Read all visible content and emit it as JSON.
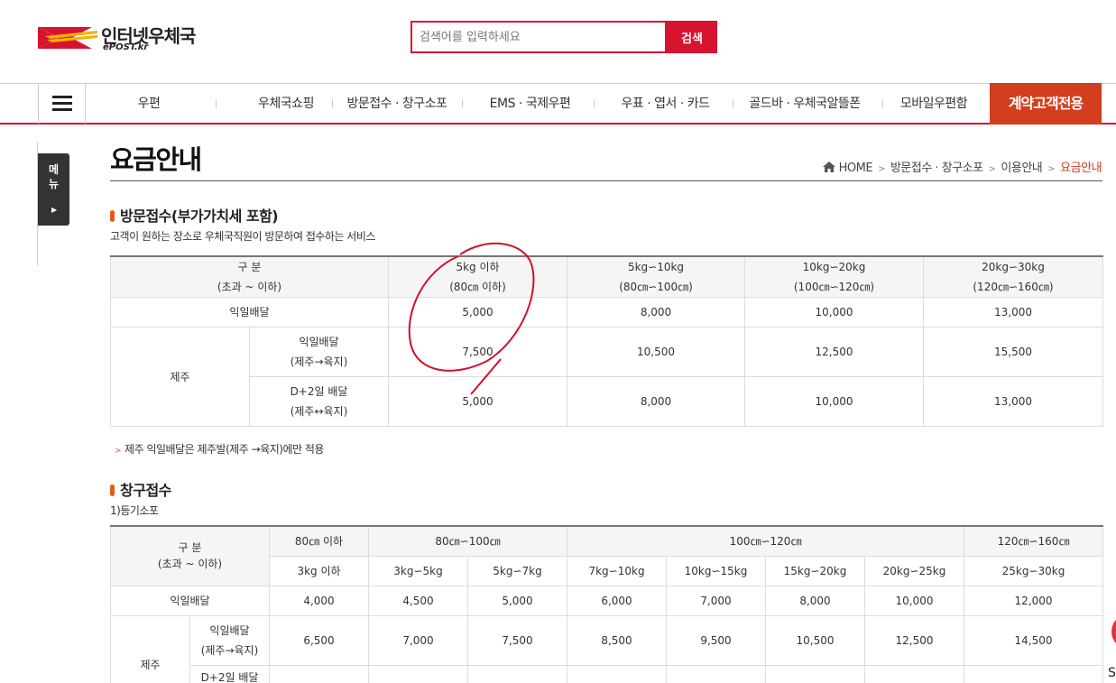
{
  "header": {
    "logo_name": "인터넷우체국",
    "logo_sub": "ePOST.kr",
    "search_placeholder": "검색어를 입력하세요",
    "search_button": "검색"
  },
  "nav": {
    "items": [
      "우편",
      "우체국쇼핑",
      "방문접수 · 창구소포",
      "EMS · 국제우편",
      "우표 · 엽서 · 카드",
      "골드바 · 우체국알뜰폰",
      "모바일우편함"
    ],
    "special": "계약고객전용"
  },
  "side_tab": {
    "label": "메뉴",
    "arrow": "▶"
  },
  "page": {
    "title": "요금안내",
    "breadcrumb": [
      "HOME",
      "방문접수 · 창구소포",
      "이용안내",
      "요금안내"
    ]
  },
  "section1": {
    "title": "방문접수(부가가치세 포함)",
    "desc": "고객이 원하는 장소로 우체국직원이 방문하여 접수하는 서비스",
    "header": {
      "label": [
        "구 분",
        "(초과 ~ 이하)"
      ],
      "cols": [
        [
          "5kg 이하",
          "(80㎝ 이하)"
        ],
        [
          "5kg∽10kg",
          "(80㎝∽100㎝)"
        ],
        [
          "10kg∽20kg",
          "(100㎝∽120㎝)"
        ],
        [
          "20kg∽30kg",
          "(120㎝∽160㎝)"
        ]
      ]
    },
    "rows": {
      "next_day_label": "익일배달",
      "next_day": [
        "5,000",
        "8,000",
        "10,000",
        "13,000"
      ],
      "jeju_label": "제주",
      "jeju_next_label": [
        "익일배달",
        "(제주→육지)"
      ],
      "jeju_next": [
        "7,500",
        "10,500",
        "12,500",
        "15,500"
      ],
      "jeju_d2_label": [
        "D+2일 배달",
        "(제주↔육지)"
      ],
      "jeju_d2": [
        "5,000",
        "8,000",
        "10,000",
        "13,000"
      ]
    },
    "note": "제주 익일배달은 제주발(제주 →육지)에만 적용"
  },
  "section2": {
    "title": "창구접수",
    "subtitle": "1)등기소포",
    "header": {
      "label": [
        "구 분",
        "(초과 ~ 이하)"
      ],
      "groups": [
        "80㎝ 이하",
        "80㎝∽100㎝",
        "100㎝∽120㎝",
        "120㎝∽160㎝"
      ],
      "weights": [
        "3kg 이하",
        "3kg∽5kg",
        "5kg∽7kg",
        "7kg∽10kg",
        "10kg∽15kg",
        "15kg∽20kg",
        "20kg∽25kg",
        "25kg∽30kg"
      ]
    },
    "rows": {
      "next_day_label": "익일배달",
      "next_day": [
        "4,000",
        "4,500",
        "5,000",
        "6,000",
        "7,000",
        "8,000",
        "10,000",
        "12,000"
      ],
      "jeju_label": "제주",
      "jeju_next_label": [
        "익일배달",
        "(제주→육지)"
      ],
      "jeju_next": [
        "6,500",
        "7,000",
        "7,500",
        "8,500",
        "9,500",
        "10,500",
        "12,500",
        "14,500"
      ],
      "jeju_d2_label_first": "D+2일 배달"
    }
  },
  "edge_text": "S",
  "colors": {
    "brand_red": "#d7132f",
    "accent_orange": "#d23e1e",
    "annotation_red": "#d2102a"
  }
}
